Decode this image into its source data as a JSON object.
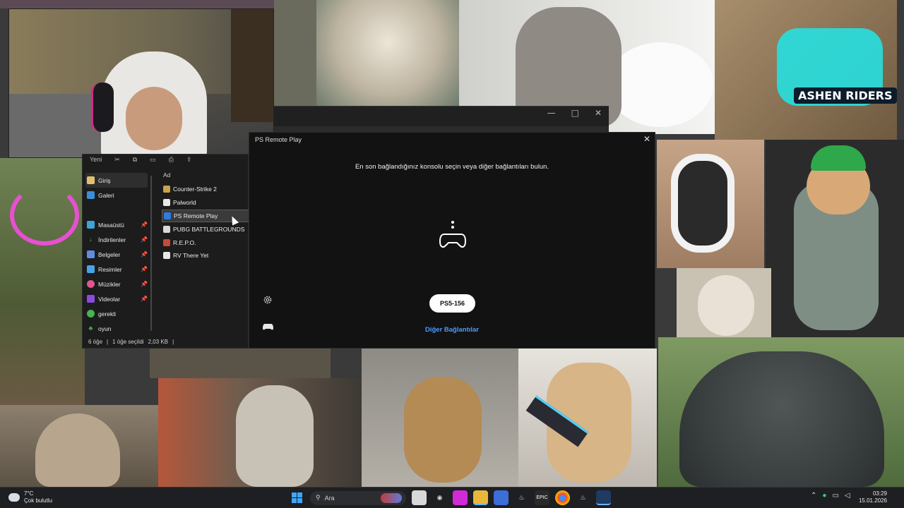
{
  "wallpaper": {
    "logo_text": "ASHEN RIDERS"
  },
  "explorer": {
    "toolbar": [
      "Yeni",
      "✂",
      "⧉",
      "▭",
      "⎙",
      "⇪"
    ],
    "nav": [
      {
        "label": "Giriş",
        "icon": "home-icon",
        "active": true
      },
      {
        "label": "Galeri",
        "icon": "gallery-icon"
      },
      {
        "label": "Masaüstü",
        "icon": "desktop-icon",
        "pinned": true
      },
      {
        "label": "İndirilenler",
        "icon": "download-icon",
        "pinned": true
      },
      {
        "label": "Belgeler",
        "icon": "documents-icon",
        "pinned": true
      },
      {
        "label": "Resimler",
        "icon": "pictures-icon",
        "pinned": true
      },
      {
        "label": "Müzikler",
        "icon": "music-icon",
        "pinned": true
      },
      {
        "label": "Videolar",
        "icon": "videos-icon",
        "pinned": true
      },
      {
        "label": "gerekli",
        "icon": "folder-icon"
      },
      {
        "label": "oyun",
        "icon": "folder-icon"
      }
    ],
    "column_header": "Ad",
    "files": [
      {
        "name": "Counter-Strike 2",
        "selected": false
      },
      {
        "name": "Palworld",
        "selected": false
      },
      {
        "name": "PS Remote Play",
        "selected": true
      },
      {
        "name": "PUBG BATTLEGROUNDS",
        "selected": false
      },
      {
        "name": "R.E.P.O.",
        "selected": false
      },
      {
        "name": "RV There Yet",
        "selected": false
      }
    ],
    "status": {
      "count": "6 öğe",
      "selection": "1 öğe seçildi",
      "size": "2,03 KB"
    }
  },
  "remote_play": {
    "title": "PS Remote Play",
    "subtitle": "En son bağlandığınız konsolu seçin veya diğer bağlantıları bulun.",
    "console_button": "PS5-156",
    "other_connections": "Diğer Bağlantılar"
  },
  "taskbar": {
    "weather_temp": "7°C",
    "weather_desc": "Çok bulutlu",
    "search_placeholder": "Ara",
    "time": "03:29",
    "date": "15.01.2026",
    "accent": "#3ea6ff"
  }
}
